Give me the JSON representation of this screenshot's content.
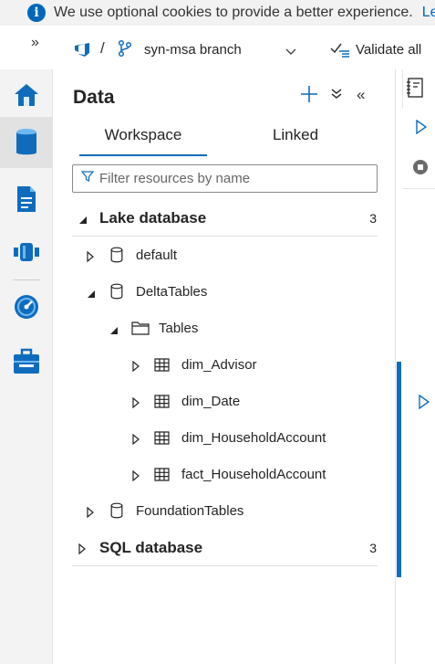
{
  "cookie_banner": {
    "icon": "info-icon",
    "message": "We use optional cookies to provide a better experience.",
    "link": "Le"
  },
  "toolbar": {
    "expand_icon": "»",
    "separator": "/",
    "branch": "syn-msa branch",
    "validate_label": "Validate all"
  },
  "rail": {
    "items": [
      "home-icon",
      "data-icon",
      "develop-icon",
      "integrate-icon",
      "monitor-icon",
      "manage-icon"
    ],
    "active": "data-icon"
  },
  "panel": {
    "title": "Data",
    "hide_icon": "«",
    "tabs": [
      {
        "label": "Workspace",
        "selected": true
      },
      {
        "label": "Linked",
        "selected": false
      }
    ],
    "filter_placeholder": "Filter resources by name",
    "tree": [
      {
        "label": "Lake database",
        "type": "section",
        "expanded": true,
        "count": "3"
      },
      {
        "label": "default",
        "type": "database",
        "expanded": false
      },
      {
        "label": "DeltaTables",
        "type": "database",
        "expanded": true
      },
      {
        "label": "Tables",
        "type": "folder",
        "expanded": true
      },
      {
        "label": "dim_Advisor",
        "type": "table",
        "expanded": false
      },
      {
        "label": "dim_Date",
        "type": "table",
        "expanded": false
      },
      {
        "label": "dim_HouseholdAccount",
        "type": "table",
        "expanded": false
      },
      {
        "label": "fact_HouseholdAccount",
        "type": "table",
        "expanded": false
      },
      {
        "label": "FoundationTables",
        "type": "database",
        "expanded": false
      },
      {
        "label": "SQL database",
        "type": "section",
        "expanded": false,
        "count": "3"
      }
    ]
  },
  "colors": {
    "accent": "#0f6cbd",
    "rail_bg": "#f3f3f3",
    "banner_bg": "#f2f2f2"
  }
}
